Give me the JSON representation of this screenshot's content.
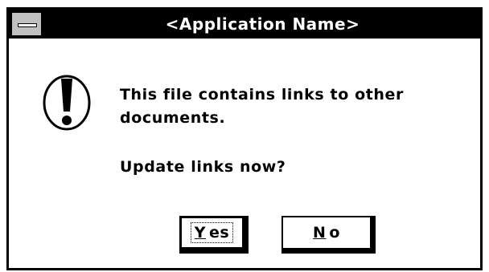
{
  "window": {
    "title": "<Application Name>"
  },
  "message": {
    "text": "This file contains links to other documents.",
    "question": "Update links now?"
  },
  "buttons": {
    "yes": {
      "mnemonic": "Y",
      "rest": "es"
    },
    "no": {
      "mnemonic": "N",
      "rest": "o"
    }
  },
  "icons": {
    "system_menu": "system-menu-icon",
    "alert": "exclamation-icon"
  }
}
